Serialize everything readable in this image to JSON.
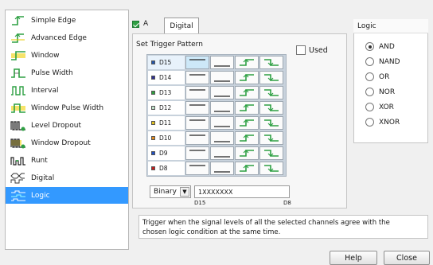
{
  "trigger_list": [
    {
      "label": "Simple Edge",
      "icon": "simple-edge-icon"
    },
    {
      "label": "Advanced Edge",
      "icon": "advanced-edge-icon"
    },
    {
      "label": "Window",
      "icon": "window-icon"
    },
    {
      "label": "Pulse Width",
      "icon": "pulse-width-icon"
    },
    {
      "label": "Interval",
      "icon": "interval-icon"
    },
    {
      "label": "Window Pulse Width",
      "icon": "window-pulse-width-icon"
    },
    {
      "label": "Level Dropout",
      "icon": "level-dropout-icon"
    },
    {
      "label": "Window Dropout",
      "icon": "window-dropout-icon"
    },
    {
      "label": "Runt",
      "icon": "runt-icon"
    },
    {
      "label": "Digital",
      "icon": "digital-icon"
    },
    {
      "label": "Logic",
      "icon": "logic-icon",
      "selected": true
    }
  ],
  "tabs": {
    "channel_a_label": "A",
    "digital_label": "Digital"
  },
  "pattern": {
    "title": "Set Trigger Pattern",
    "used_label": "Used",
    "channels": [
      {
        "name": "D15",
        "dot_color": "#2255aa",
        "selected": true
      },
      {
        "name": "D14",
        "dot_color": "#303090"
      },
      {
        "name": "D13",
        "dot_color": "#2e9d3e"
      },
      {
        "name": "D12",
        "dot_color": "#bfe0c8"
      },
      {
        "name": "D11",
        "dot_color": "#e0c020"
      },
      {
        "name": "D10",
        "dot_color": "#e08a20"
      },
      {
        "name": "D9",
        "dot_color": "#2250c0"
      },
      {
        "name": "D8",
        "dot_color": "#c02020"
      }
    ],
    "state_buttons": [
      "high-level-icon",
      "low-level-icon",
      "rising-edge-icon",
      "falling-edge-icon"
    ],
    "format": {
      "select_value": "Binary",
      "value": "1XXXXXXX",
      "left_label": "D15",
      "right_label": "D8"
    }
  },
  "logic": {
    "title": "Logic",
    "options": [
      {
        "label": "AND",
        "selected": true
      },
      {
        "label": "NAND"
      },
      {
        "label": "OR"
      },
      {
        "label": "NOR"
      },
      {
        "label": "XOR"
      },
      {
        "label": "XNOR"
      }
    ]
  },
  "description": {
    "line1": "Trigger when the signal levels of all the selected channels agree with the",
    "line2": "chosen logic condition at the same time."
  },
  "buttons": {
    "help": "Help",
    "close": "Close"
  },
  "colors": {
    "selection": "#3399ff",
    "edge_green": "#2ea043",
    "icon_yellow": "#e6c800"
  }
}
